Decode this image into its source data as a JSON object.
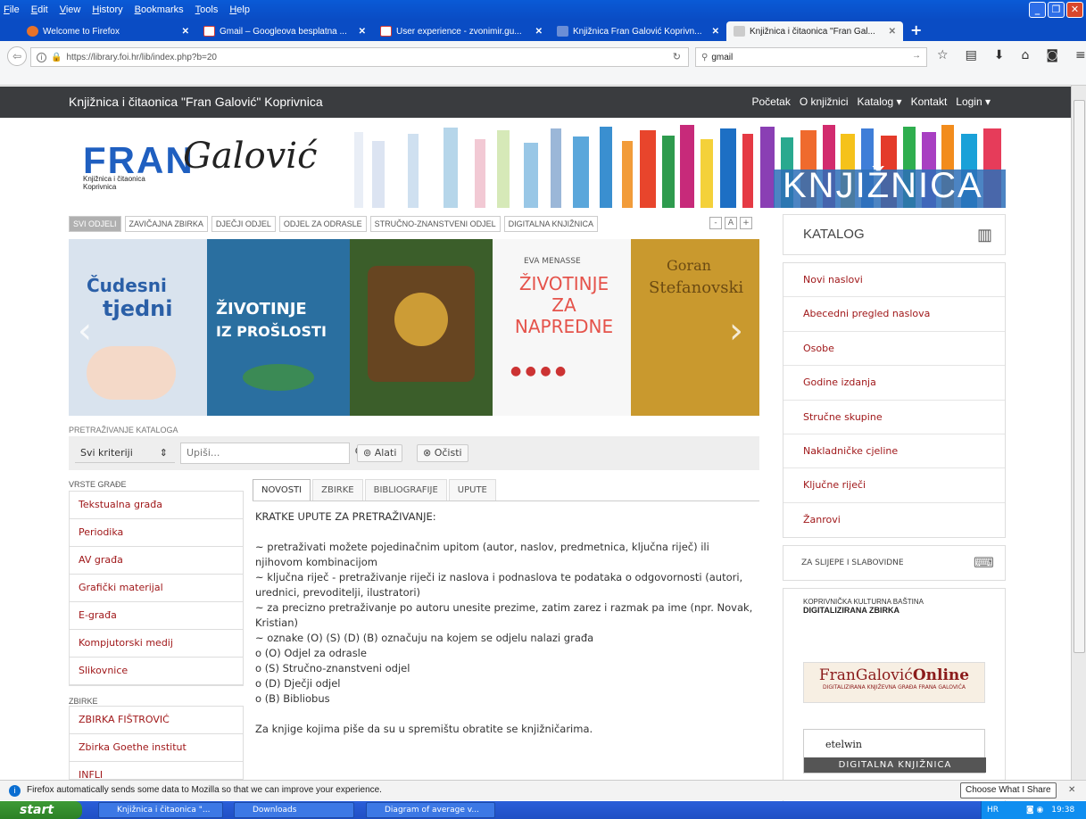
{
  "menubar": {
    "items": [
      "File",
      "Edit",
      "View",
      "History",
      "Bookmarks",
      "Tools",
      "Help"
    ]
  },
  "tabs": [
    {
      "title": "Welcome to Firefox",
      "color": "#e8722a"
    },
    {
      "title": "Gmail – Googleova besplatna ...",
      "color": "#d83a31"
    },
    {
      "title": "User experience - zvonimir.gu...",
      "color": "#d83a31"
    },
    {
      "title": "Knjižnica Fran Galović Koprivn...",
      "color": "#6b8ed6"
    },
    {
      "title": "Knjižnica i čitaonica \"Fran Gal...",
      "color": "#888888"
    }
  ],
  "nav": {
    "url": "https://library.foi.hr/lib/index.php?b=20",
    "search": "gmail"
  },
  "site": {
    "brand": "Knjižnica i čitaonica \"Fran Galović\" Koprivnica",
    "nav": [
      "Početak",
      "O knjižnici",
      "Katalog ▾",
      "Kontakt",
      "Login ▾"
    ]
  },
  "banner": {
    "fran": "FRAN",
    "galovic": "Galović",
    "sub1": "Knjižnica i čitaonica",
    "sub2": "Koprivnica",
    "knjiznica": "KNJIŽNICA"
  },
  "dept_tabs": [
    "SVI ODJELI",
    "ZAVIČAJNA ZBIRKA",
    "DJEČJI ODJEL",
    "ODJEL ZA ODRASLE",
    "STRUČNO-ZNANSTVENI ODJEL",
    "DIGITALNA KNJIŽNICA"
  ],
  "font_controls": [
    "-",
    "A",
    "+"
  ],
  "books": [
    {
      "t1": "Čudesni",
      "t2": "tjedni",
      "bg": "#d9e3ee",
      "fg": "#2a5fa7"
    },
    {
      "t1": "ŽIVOTINJE",
      "t2": "IZ PROŠLOSTI",
      "bg": "#2a6fa0",
      "fg": "#ffffff"
    },
    {
      "t1": "",
      "t2": "",
      "bg": "#3b5e2a",
      "fg": "#ffcc55"
    },
    {
      "t1": "EVA MENASSE",
      "t2": "ŽIVOTINJE ZA NAPREDNE",
      "bg": "#f7f7f7",
      "fg": "#e5534b"
    },
    {
      "t1": "Goran",
      "t2": "Stefanovski",
      "bg": "#c9992e",
      "fg": "#6b4a12"
    }
  ],
  "search": {
    "title": "PRETRAŽIVANJE KATALOGA",
    "select": "Svi kriteriji",
    "placeholder": "Upiši...",
    "alati": "Alati",
    "ocisti": "Očisti"
  },
  "vrste": {
    "title": "VRSTE GRAĐE",
    "items": [
      "Tekstualna građa",
      "Periodika",
      "AV građa",
      "Grafički materijal",
      "E-građa",
      "Kompjutorski medij",
      "Slikovnice"
    ]
  },
  "zbirke": {
    "title": "ZBIRKE",
    "items": [
      "ZBIRKA FIŠTROVIĆ",
      "Zbirka Goethe institut",
      "INFLI"
    ]
  },
  "content_tabs": [
    "NOVOSTI",
    "ZBIRKE",
    "BIBLIOGRAFIJE",
    "UPUTE"
  ],
  "content": {
    "heading": "KRATKE UPUTE ZA PRETRAŽIVANJE:",
    "p1": "~ pretraživati možete pojedinačnim upitom (autor, naslov, predmetnica, ključna riječ) ili njihovom kombinacijom",
    "p2": "~ ključna riječ - pretraživanje riječi iz naslova i podnaslova te podataka o odgovornosti (autori, urednici, prevoditelji, ilustratori)",
    "p3": "~ za precizno pretraživanje po autoru unesite prezime, zatim zarez i razmak pa ime (npr. Novak, Kristian)",
    "p4": "~ oznake (O) (S) (D) (B) označuju na kojem se odjelu nalazi građa",
    "p5": "o (O) Odjel za odrasle",
    "p6": "o (S) Stručno-znanstveni odjel",
    "p7": "o (D) Dječji odjel",
    "p8": "o (B) Bibliobus",
    "p9": "Za knjige kojima piše da su u spremištu obratite se knjižničarima."
  },
  "katalog": {
    "title": "KATALOG",
    "items": [
      "Novi naslovi",
      "Abecedni pregled naslova",
      "Osobe",
      "Godine izdanja",
      "Stručne skupine",
      "Nakladničke cjeline",
      "Ključne riječi",
      "Žanrovi"
    ]
  },
  "slijepe": "ZA SLIJEPE I SLABOVIDNE",
  "rbanners": {
    "b1l1": "KOPRIVNIČKA KULTURNA BAŠTINA",
    "b1l2": "DIGITALIZIRANA ZBIRKA",
    "b2a": "FranGalović",
    "b2b": "Online",
    "b2sub": "DIGITALIZIRANA KNJIŽEVNA GRAĐA FRANA GALOVIĆA",
    "b3a": "etelwin",
    "b3b": "DIGITALNA KNJIŽNICA"
  },
  "notification": {
    "text": "Firefox automatically sends some data to Mozilla so that we can improve your experience.",
    "button": "Choose What I Share"
  },
  "taskbar": {
    "start": "start",
    "tasks": [
      "Knjižnica i čitaonica \"...",
      "Downloads",
      "Diagram of average v..."
    ],
    "lang": "HR",
    "time": "19:38"
  }
}
